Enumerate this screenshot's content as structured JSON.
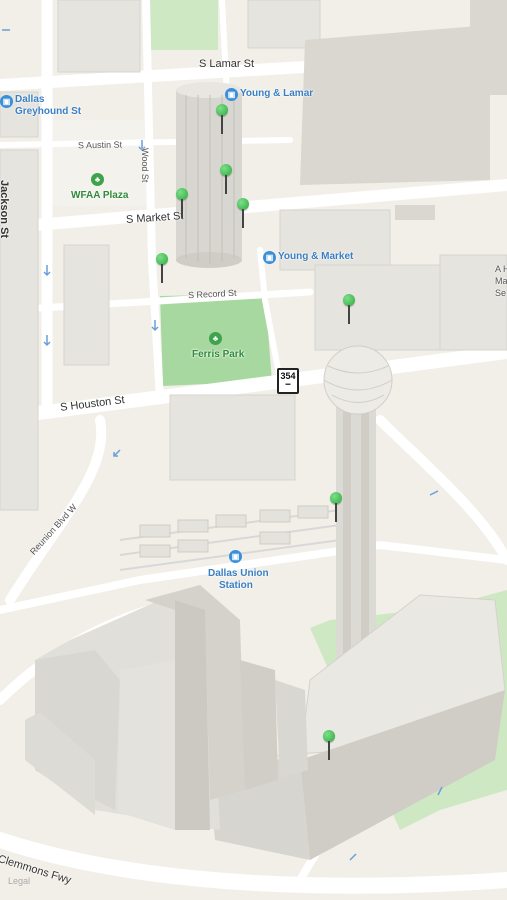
{
  "map": {
    "streets": {
      "s_lamar": "S Lamar St",
      "s_austin": "S Austin St",
      "jackson": "Jackson St",
      "wood": "Wood St",
      "s_market": "S Market St",
      "s_record": "S Record St",
      "s_houston": "S Houston St",
      "reunion": "Reunion Blvd W",
      "clemmons": "Clemmons Fwy"
    },
    "transit": {
      "greyhound": [
        "Dallas",
        "Greyhound St"
      ],
      "young_lamar": "Young & Lamar",
      "young_market": "Young & Market",
      "union_station": [
        "Dallas Union",
        "Station"
      ]
    },
    "parks": {
      "wfaa": "WFAA Plaza",
      "ferris": "Ferris Park"
    },
    "highway_shield": {
      "number": "354"
    },
    "partial_label": [
      "A H",
      "Ma",
      "Se"
    ],
    "legal": "Legal"
  }
}
